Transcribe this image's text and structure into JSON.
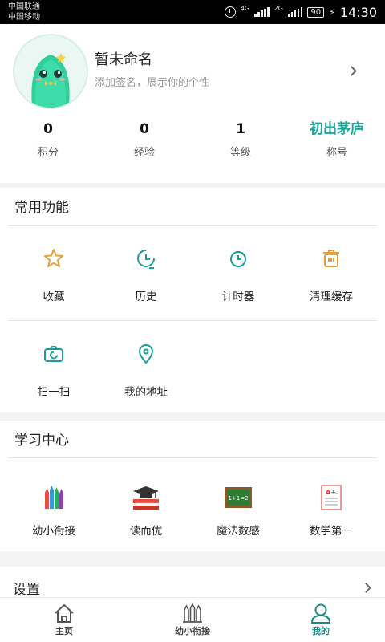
{
  "status_bar": {
    "carrier1": "中国联通",
    "carrier2": "中国移动",
    "network1": "4G",
    "network2": "2G",
    "battery": "90",
    "time": "14:30"
  },
  "profile": {
    "name": "暂未命名",
    "signature": "添加签名，展示你的个性",
    "stats": [
      {
        "value": "0",
        "label": "积分"
      },
      {
        "value": "0",
        "label": "经验"
      },
      {
        "value": "1",
        "label": "等级"
      },
      {
        "value": "初出茅庐",
        "label": "称号"
      }
    ]
  },
  "common_functions": {
    "title": "常用功能",
    "items": [
      {
        "label": "收藏",
        "icon": "star-icon"
      },
      {
        "label": "历史",
        "icon": "history-clock-icon"
      },
      {
        "label": "计时器",
        "icon": "timer-icon"
      },
      {
        "label": "清理缓存",
        "icon": "trash-icon"
      },
      {
        "label": "扫一扫",
        "icon": "scan-camera-icon"
      },
      {
        "label": "我的地址",
        "icon": "location-pin-icon"
      }
    ]
  },
  "study_center": {
    "title": "学习中心",
    "items": [
      {
        "label": "幼小衔接",
        "icon": "pencils-icon"
      },
      {
        "label": "读而优",
        "icon": "graduation-books-icon"
      },
      {
        "label": "魔法数感",
        "icon": "math-blackboard-icon",
        "board_text": "1+1=2"
      },
      {
        "label": "数学第一",
        "icon": "grade-paper-icon",
        "paper_text": "A+"
      }
    ]
  },
  "settings": {
    "label": "设置"
  },
  "tabbar": {
    "tabs": [
      {
        "label": "主页",
        "icon": "home-icon",
        "active": false
      },
      {
        "label": "幼小衔接",
        "icon": "pencils-outline-icon",
        "active": false
      },
      {
        "label": "我的",
        "icon": "user-icon",
        "active": true
      }
    ]
  },
  "colors": {
    "accent": "#1aa69a",
    "status_bar": "#000000",
    "icon_orange": "#e2a13a",
    "icon_teal": "#1a9e95"
  }
}
